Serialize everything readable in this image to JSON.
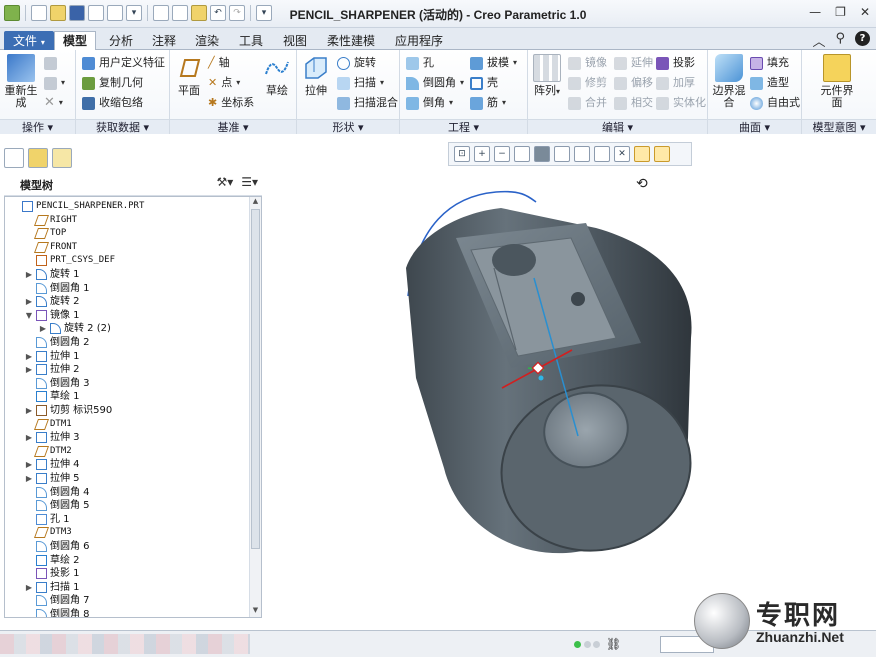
{
  "window": {
    "title": "PENCIL_SHARPENER (活动的) - Creo Parametric 1.0"
  },
  "tabs": [
    {
      "label": "文件",
      "dropdown": "▾"
    },
    {
      "label": "模型"
    },
    {
      "label": "分析"
    },
    {
      "label": "注释"
    },
    {
      "label": "渲染"
    },
    {
      "label": "工具"
    },
    {
      "label": "视图"
    },
    {
      "label": "柔性建模"
    },
    {
      "label": "应用程序"
    }
  ],
  "ribbon": {
    "groups": {
      "operations": "操作",
      "get_data": "获取数据",
      "datum": "基准",
      "shapes": "形状",
      "engineering": "工程",
      "editing": "编辑",
      "surfaces": "曲面",
      "model_intent": "模型意图"
    },
    "regenerate": "重新生成",
    "user_defined_feature": "用户定义特征",
    "copy_geometry": "复制几何",
    "shrinkwrap": "收缩包络",
    "plane": "平面",
    "axis": "轴",
    "point": "点",
    "csys": "坐标系",
    "sketch": "草绘",
    "extrude": "拉伸",
    "revolve": "旋转",
    "sweep": "扫描",
    "swept_blend": "扫描混合",
    "hole": "孔",
    "round": "倒圆角",
    "chamfer": "倒角",
    "draft": "拔模",
    "shell": "壳",
    "rib": "筋",
    "pattern": "阵列",
    "mirror": "镜像",
    "trim": "修剪",
    "merge": "合并",
    "extend": "延伸",
    "offset": "偏移",
    "intersect": "相交",
    "project": "投影",
    "thicken": "加厚",
    "solidify": "实体化",
    "boundary_blend": "边界混合",
    "fill": "填充",
    "style": "造型",
    "freestyle": "自由式",
    "component_interface": "元件界面"
  },
  "model_tree": {
    "title": "模型树",
    "items": [
      {
        "label": "PENCIL_SHARPENER.PRT",
        "level": 0,
        "expander": "",
        "icon": "part-icon",
        "mono": true
      },
      {
        "label": "RIGHT",
        "level": 1,
        "expander": "",
        "icon": "datum-plane-icon",
        "mono": true
      },
      {
        "label": "TOP",
        "level": 1,
        "expander": "",
        "icon": "datum-plane-icon",
        "mono": true
      },
      {
        "label": "FRONT",
        "level": 1,
        "expander": "",
        "icon": "datum-plane-icon",
        "mono": true
      },
      {
        "label": "PRT_CSYS_DEF",
        "level": 1,
        "expander": "",
        "icon": "csys-icon",
        "mono": true
      },
      {
        "label": "旋转 1",
        "level": 1,
        "expander": "▶",
        "icon": "revolve-icon",
        "mono": false
      },
      {
        "label": "倒圆角 1",
        "level": 1,
        "expander": "",
        "icon": "round-icon",
        "mono": false
      },
      {
        "label": "旋转 2",
        "level": 1,
        "expander": "▶",
        "icon": "revolve-icon",
        "mono": false
      },
      {
        "label": "镜像 1",
        "level": 1,
        "expander": "▼",
        "icon": "mirror-icon",
        "mono": false
      },
      {
        "label": "旋转 2 (2)",
        "level": 2,
        "expander": "▶",
        "icon": "revolve-icon",
        "mono": false
      },
      {
        "label": "倒圆角 2",
        "level": 1,
        "expander": "",
        "icon": "round-icon",
        "mono": false
      },
      {
        "label": "拉伸 1",
        "level": 1,
        "expander": "▶",
        "icon": "extrude-icon",
        "mono": false
      },
      {
        "label": "拉伸 2",
        "level": 1,
        "expander": "▶",
        "icon": "extrude-icon",
        "mono": false
      },
      {
        "label": "倒圆角 3",
        "level": 1,
        "expander": "",
        "icon": "round-icon",
        "mono": false
      },
      {
        "label": "草绘 1",
        "level": 1,
        "expander": "",
        "icon": "sketch-icon",
        "mono": false
      },
      {
        "label": "切剪 标识590",
        "level": 1,
        "expander": "▶",
        "icon": "cut-icon",
        "mono": false
      },
      {
        "label": "DTM1",
        "level": 1,
        "expander": "",
        "icon": "datum-plane-icon",
        "mono": true
      },
      {
        "label": "拉伸 3",
        "level": 1,
        "expander": "▶",
        "icon": "extrude-icon",
        "mono": false
      },
      {
        "label": "DTM2",
        "level": 1,
        "expander": "",
        "icon": "datum-plane-icon",
        "mono": true
      },
      {
        "label": "拉伸 4",
        "level": 1,
        "expander": "▶",
        "icon": "extrude-icon",
        "mono": false
      },
      {
        "label": "拉伸 5",
        "level": 1,
        "expander": "▶",
        "icon": "extrude-icon",
        "mono": false
      },
      {
        "label": "倒圆角 4",
        "level": 1,
        "expander": "",
        "icon": "round-icon",
        "mono": false
      },
      {
        "label": "倒圆角 5",
        "level": 1,
        "expander": "",
        "icon": "round-icon",
        "mono": false
      },
      {
        "label": "孔 1",
        "level": 1,
        "expander": "",
        "icon": "hole-icon",
        "mono": false
      },
      {
        "label": "DTM3",
        "level": 1,
        "expander": "",
        "icon": "datum-plane-icon",
        "mono": true
      },
      {
        "label": "倒圆角 6",
        "level": 1,
        "expander": "",
        "icon": "round-icon",
        "mono": false
      },
      {
        "label": "草绘 2",
        "level": 1,
        "expander": "",
        "icon": "sketch-icon",
        "mono": false
      },
      {
        "label": "投影 1",
        "level": 1,
        "expander": "",
        "icon": "project-icon",
        "mono": false
      },
      {
        "label": "扫描 1",
        "level": 1,
        "expander": "▶",
        "icon": "sweep-icon",
        "mono": false
      },
      {
        "label": "倒圆角 7",
        "level": 1,
        "expander": "",
        "icon": "round-icon",
        "mono": false
      },
      {
        "label": "倒圆角 8",
        "level": 1,
        "expander": "",
        "icon": "round-icon",
        "mono": false
      }
    ]
  },
  "watermark": {
    "cn": "专职网",
    "en": "Zhuanzhi.Net"
  },
  "colors": {
    "file_tab": "#3c6eb4",
    "model_body": "#4f5a62",
    "datum_axis": "#2a8fd0",
    "dragger_red": "#d21f1f",
    "status_ok": "#3cc04a"
  }
}
